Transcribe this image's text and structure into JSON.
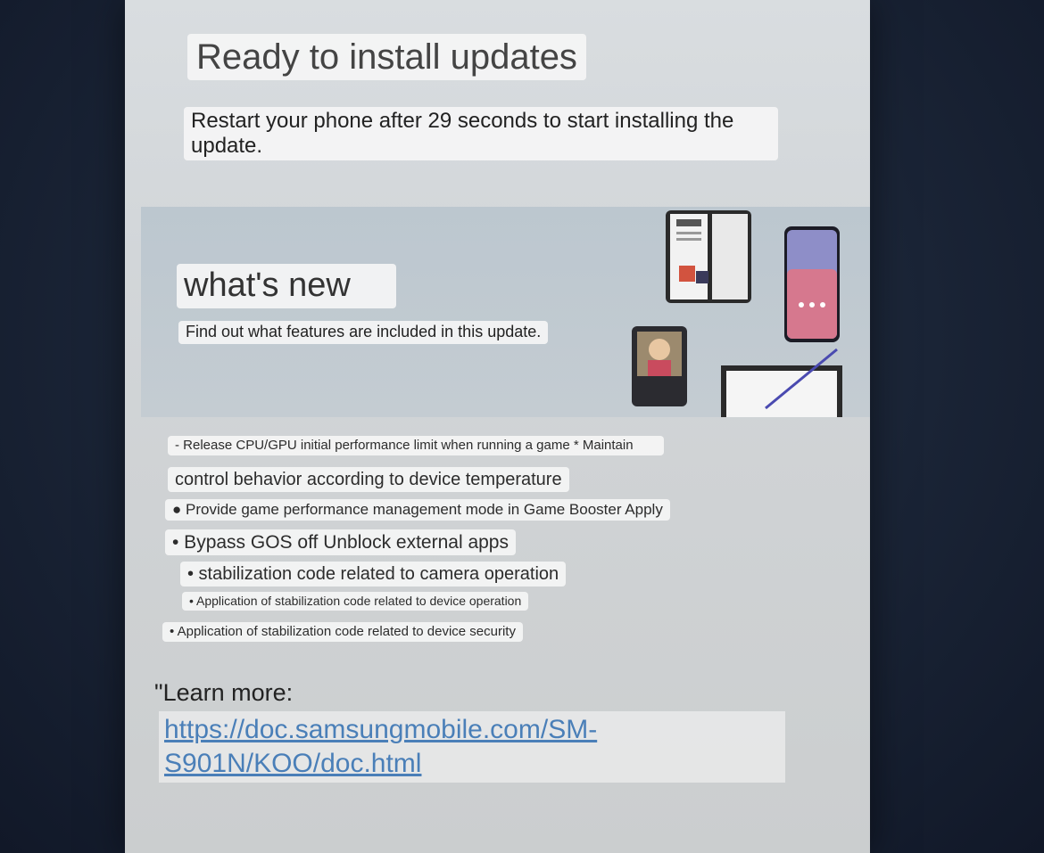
{
  "screen": {
    "title": "Ready to install updates",
    "subtitle": "Restart your phone after 29 seconds to start installing the update."
  },
  "whats_new": {
    "heading": "what's new",
    "description": "Find out what features are included in this update."
  },
  "notes": [
    "- Release CPU/GPU initial performance limit when running a game * Maintain",
    "control behavior according to device temperature",
    "● Provide game performance management mode in Game Booster Apply",
    "• Bypass GOS off Unblock external apps",
    "• stabilization code related to camera operation",
    "• Application of stabilization code related to device operation",
    "• Application of stabilization code related to device security"
  ],
  "learn_more": {
    "label": "\"Learn more:",
    "url": "https://doc.samsungmobile.com/SM-S901N/KOO/doc.html"
  },
  "colors": {
    "link": "#4a7fb8",
    "screen_bg": "#d2d6d9",
    "banner_bg": "#c0c9cf"
  }
}
